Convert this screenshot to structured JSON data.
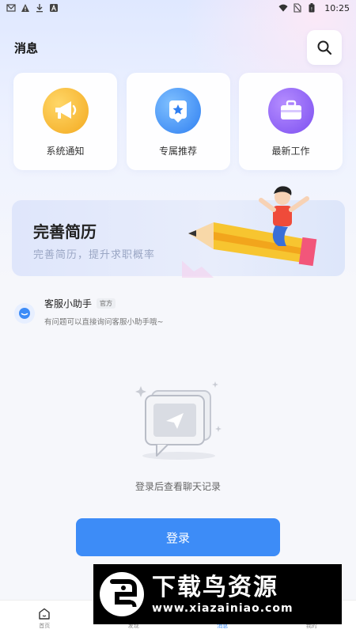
{
  "status_bar": {
    "time": "10:25"
  },
  "header": {
    "title": "消息"
  },
  "quick_cards": [
    {
      "label": "系统通知",
      "icon": "megaphone-icon",
      "color": "#f6b533"
    },
    {
      "label": "专属推荐",
      "icon": "star-badge-icon",
      "color": "#3d8cf7"
    },
    {
      "label": "最新工作",
      "icon": "briefcase-icon",
      "color": "#8a5cf5"
    }
  ],
  "banner": {
    "title": "完善简历",
    "subtitle": "完善简历，提升求职概率"
  },
  "customer_service": {
    "name": "客服小助手",
    "badge": "官方",
    "message": "有问题可以直接询问客服小助手哦~"
  },
  "empty_state": {
    "text": "登录后查看聊天记录"
  },
  "login_button": {
    "label": "登录"
  },
  "tabbar": [
    {
      "label": "首页",
      "icon": "home-icon",
      "active": false
    },
    {
      "label": "发现",
      "icon": "discover-icon",
      "active": false
    },
    {
      "label": "消息",
      "icon": "message-icon",
      "active": true
    },
    {
      "label": "我的",
      "icon": "profile-icon",
      "active": false
    }
  ],
  "watermark": {
    "title": "下载鸟资源",
    "url": "www.xiazainiao.com"
  },
  "colors": {
    "accent": "#3d8cf7",
    "background": "#f6f7fb"
  }
}
